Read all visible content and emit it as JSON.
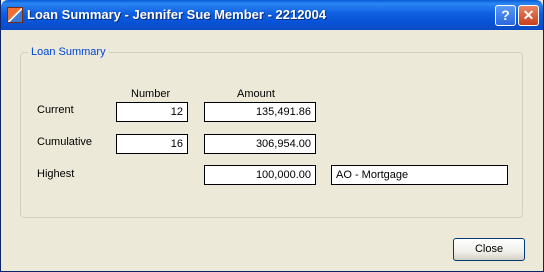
{
  "window": {
    "title": "Loan Summary - Jennifer Sue Member - 2212004",
    "help_label": "?",
    "close_label": "✕"
  },
  "group": {
    "legend": "Loan Summary",
    "col_number": "Number",
    "col_amount": "Amount",
    "rows": {
      "current": {
        "label": "Current",
        "number": "12",
        "amount": "135,491.86"
      },
      "cumulative": {
        "label": "Cumulative",
        "number": "16",
        "amount": "306,954.00"
      },
      "highest": {
        "label": "Highest",
        "amount": "100,000.00",
        "type": "AO - Mortgage"
      }
    }
  },
  "buttons": {
    "close": "Close"
  }
}
